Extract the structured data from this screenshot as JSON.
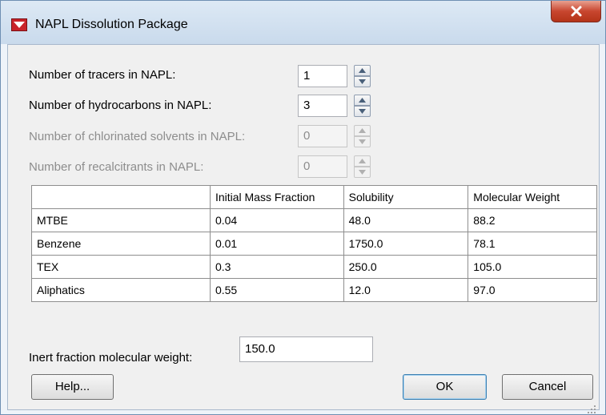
{
  "window": {
    "title": "NAPL Dissolution Package",
    "close_glyph": "X"
  },
  "form": {
    "tracers": {
      "label": "Number of tracers in NAPL:",
      "value": "1",
      "enabled": true
    },
    "hydrocarbons": {
      "label": "Number of hydrocarbons in NAPL:",
      "value": "3",
      "enabled": true
    },
    "chlorinated": {
      "label": "Number of chlorinated solvents in NAPL:",
      "value": "0",
      "enabled": false
    },
    "recalcitrants": {
      "label": "Number of recalcitrants in NAPL:",
      "value": "0",
      "enabled": false
    }
  },
  "table": {
    "headers": [
      "",
      "Initial Mass Fraction",
      "Solubility",
      "Molecular Weight"
    ],
    "rows": [
      [
        "MTBE",
        "0.04",
        "48.0",
        "88.2"
      ],
      [
        "Benzene",
        "0.01",
        "1750.0",
        "78.1"
      ],
      [
        "TEX",
        "0.3",
        "250.0",
        "105.0"
      ],
      [
        "Aliphatics",
        "0.55",
        "12.0",
        "97.0"
      ]
    ]
  },
  "inert": {
    "label": "Inert fraction molecular weight:",
    "value": "150.0"
  },
  "buttons": {
    "help": "Help...",
    "ok": "OK",
    "cancel": "Cancel"
  },
  "colors": {
    "title_accent": "#c9232a",
    "close_button": "#c8462f",
    "disabled_text": "#8d8d8d"
  },
  "icons": {
    "app": "napl-app-icon",
    "close": "close-icon",
    "spin_up": "spin-up-arrow-icon",
    "spin_down": "spin-down-arrow-icon",
    "grip": "resize-grip-icon"
  }
}
